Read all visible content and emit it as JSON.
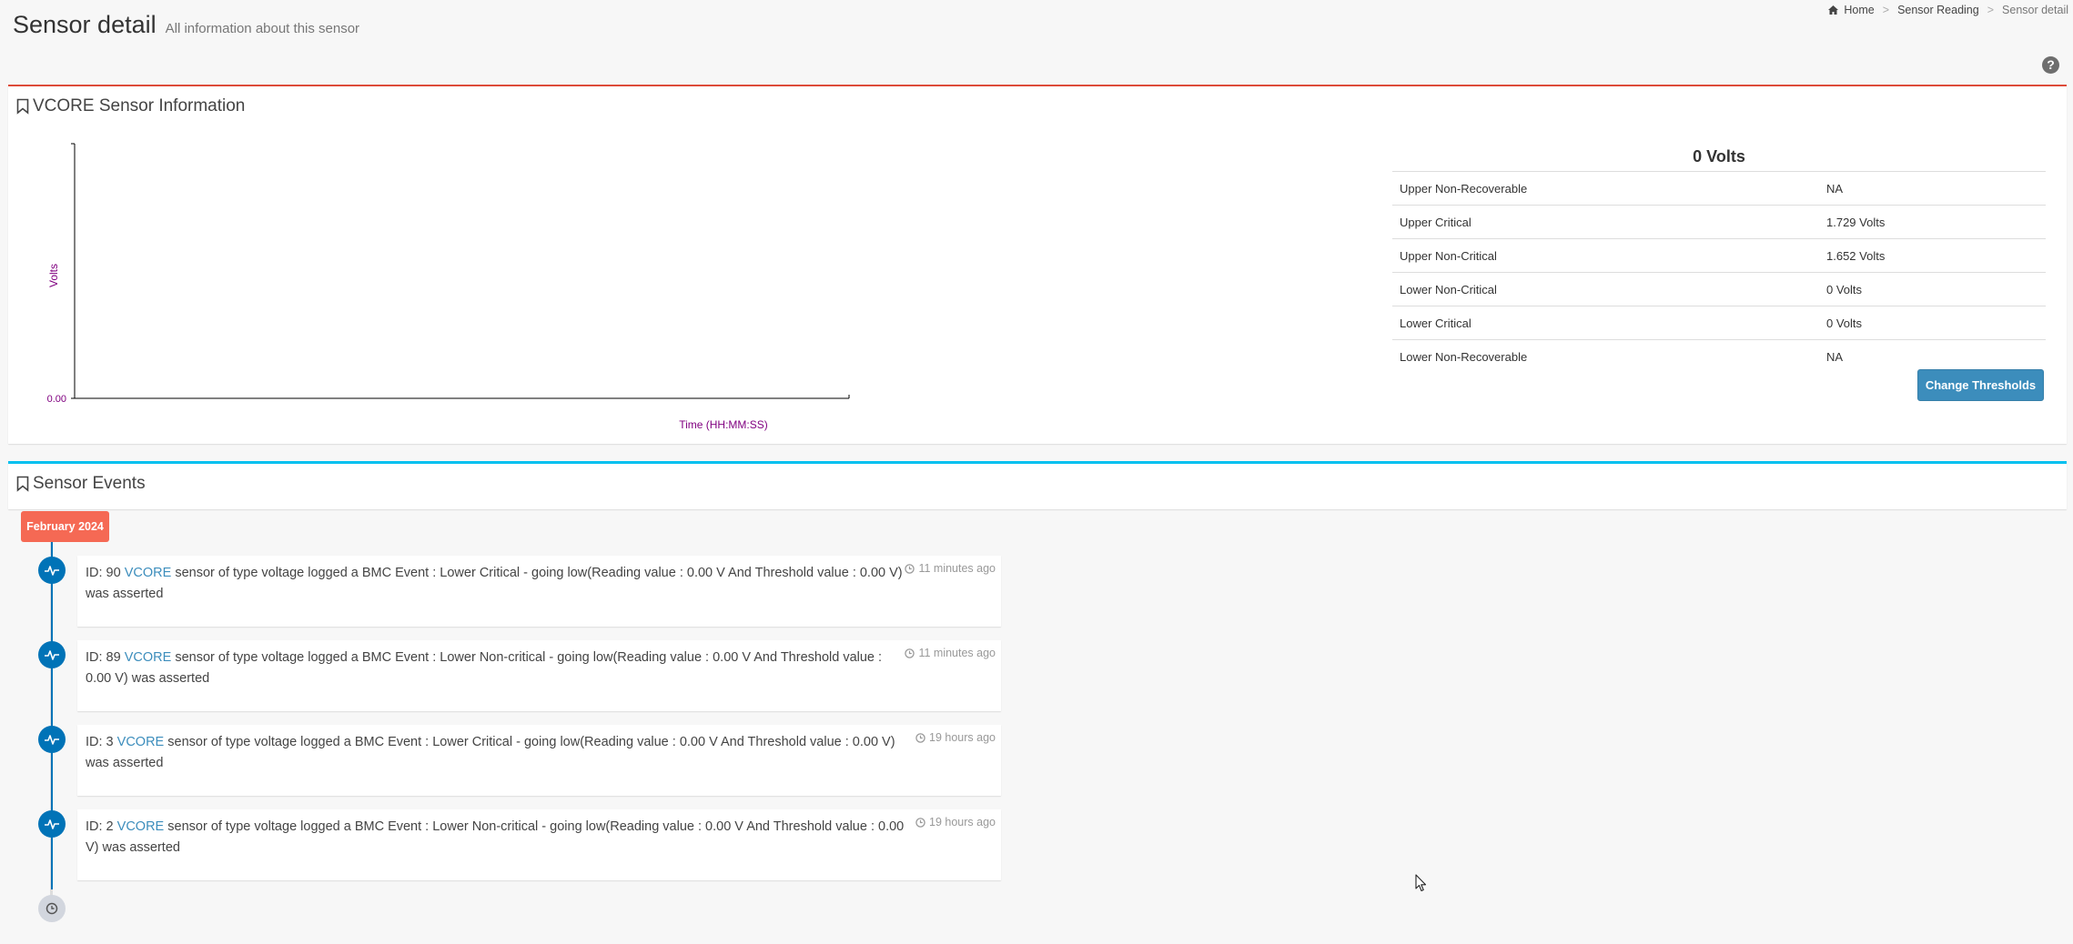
{
  "header": {
    "title": "Sensor detail",
    "subtitle": "All information about this sensor"
  },
  "breadcrumb": {
    "home": "Home",
    "parent": "Sensor Reading",
    "current": "Sensor detail"
  },
  "help": {
    "label": "?"
  },
  "sensor_info": {
    "title": "VCORE Sensor Information",
    "reading": "0 Volts",
    "thresholds": [
      {
        "name": "Upper Non-Recoverable",
        "value": "NA"
      },
      {
        "name": "Upper Critical",
        "value": "1.729 Volts"
      },
      {
        "name": "Upper Non-Critical",
        "value": "1.652 Volts"
      },
      {
        "name": "Lower Non-Critical",
        "value": "0 Volts"
      },
      {
        "name": "Lower Critical",
        "value": "0 Volts"
      },
      {
        "name": "Lower Non-Recoverable",
        "value": "NA"
      }
    ],
    "change_button": "Change Thresholds"
  },
  "chart_data": {
    "type": "line",
    "title": "",
    "xlabel": "Time (HH:MM:SS)",
    "ylabel": "Volts",
    "y_ticks": [
      "0.00"
    ],
    "series": []
  },
  "events": {
    "title": "Sensor Events",
    "time_label": "February 2024",
    "items": [
      {
        "prefix": "ID: 90",
        "sensor": "VCORE",
        "text": "sensor of type voltage logged a BMC Event : Lower Critical - going low(Reading value : 0.00 V And Threshold value : 0.00 V) was asserted",
        "time": "11 minutes ago"
      },
      {
        "prefix": "ID: 89",
        "sensor": "VCORE",
        "text": "sensor of type voltage logged a BMC Event : Lower Non-critical - going low(Reading value : 0.00 V And Threshold value : 0.00 V) was asserted",
        "time": "11 minutes ago"
      },
      {
        "prefix": "ID: 3",
        "sensor": "VCORE",
        "text": "sensor of type voltage logged a BMC Event : Lower Critical - going low(Reading value : 0.00 V And Threshold value : 0.00 V) was asserted",
        "time": "19 hours ago"
      },
      {
        "prefix": "ID: 2",
        "sensor": "VCORE",
        "text": "sensor of type voltage logged a BMC Event : Lower Non-critical - going low(Reading value : 0.00 V And Threshold value : 0.00 V) was asserted",
        "time": "19 hours ago"
      }
    ]
  },
  "colors": {
    "primary": "#3c8dbc",
    "timeline": "#0073b7",
    "time_label": "#f56954",
    "info_border": "#dd4b39",
    "events_border": "#00c0ef",
    "chart_text": "#800080"
  }
}
